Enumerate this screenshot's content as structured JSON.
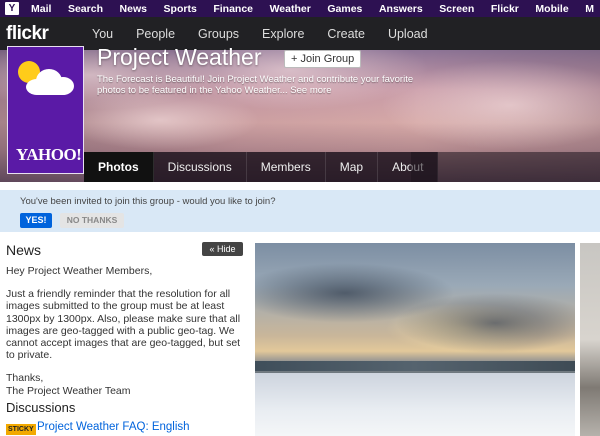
{
  "yahoo_bar": {
    "logo": "Y",
    "items": [
      "Mail",
      "Search",
      "News",
      "Sports",
      "Finance",
      "Weather",
      "Games",
      "Answers",
      "Screen",
      "Flickr",
      "Mobile",
      "M"
    ]
  },
  "flickr_nav": {
    "logo": "flickr",
    "items": [
      "You",
      "People",
      "Groups",
      "Explore",
      "Create",
      "Upload"
    ]
  },
  "group": {
    "title": "Project Weather",
    "join_label": "+ Join Group",
    "description": "The Forecast is Beautiful! Join Project Weather and contribute your favorite photos to be featured in the Yahoo Weather... See more",
    "avatar_text": "YAHOO!",
    "tabs": [
      "Photos",
      "Discussions",
      "Members",
      "Map",
      "About"
    ],
    "active_tab": "Photos"
  },
  "invite": {
    "message": "You've been invited to join this group - would you like to join?",
    "yes_label": "YES!",
    "no_label": "NO THANKS"
  },
  "news": {
    "heading": "News",
    "hide_label": "« Hide",
    "greeting": "Hey Project Weather Members,",
    "body": "Just a friendly reminder that the resolution for all images submitted to the group must be at least 1300px by 1300px. Also, please make sure that all images are geo-tagged with a public geo-tag. We cannot accept images that are geo-tagged, but set to private.",
    "signoff_1": "Thanks,",
    "signoff_2": "The Project Weather Team"
  },
  "discussions": {
    "heading": "Discussions",
    "items": [
      {
        "badge": "STICKY",
        "title": "Project Weather FAQ: English"
      }
    ]
  },
  "colors": {
    "yahoo_purple": "#2d1152",
    "flickr_bar": "#212124",
    "link_blue": "#0063dc",
    "invite_bg": "#d9e8f6",
    "sticky_badge": "#f2a900"
  }
}
